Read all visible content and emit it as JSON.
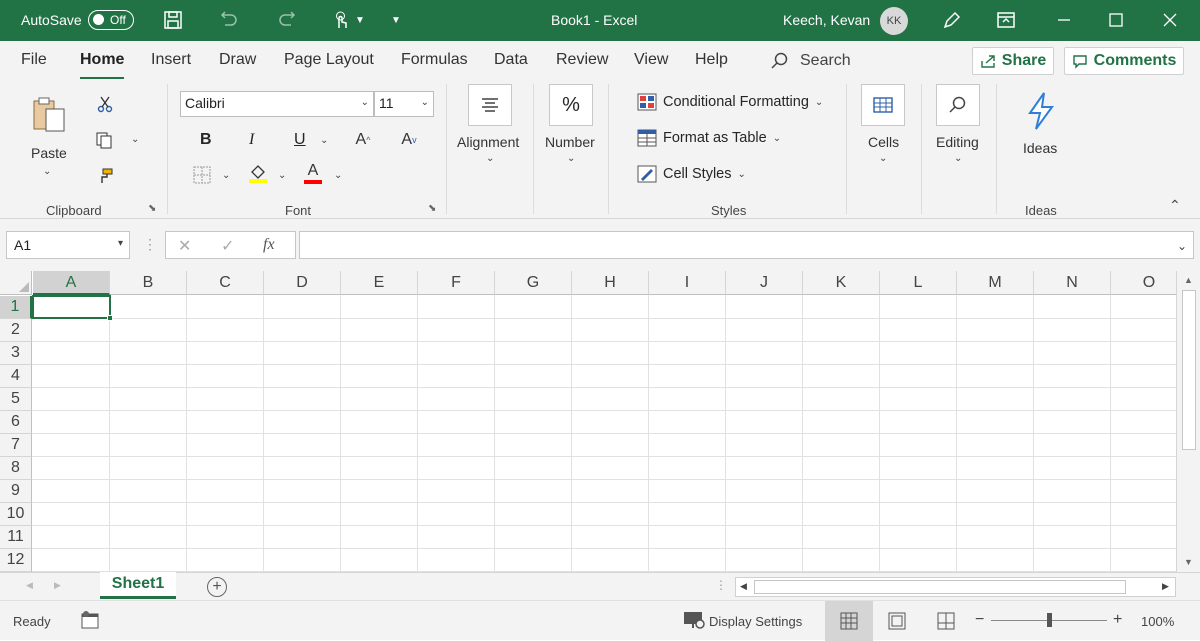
{
  "titlebar": {
    "autosave_label": "AutoSave",
    "autosave_state": "Off",
    "document_title": "Book1  -  Excel",
    "user_name": "Keech, Kevan",
    "user_initials": "KK"
  },
  "tabs": [
    "File",
    "Home",
    "Insert",
    "Draw",
    "Page Layout",
    "Formulas",
    "Data",
    "Review",
    "View",
    "Help"
  ],
  "search_label": "Search",
  "share_label": "Share",
  "comments_label": "Comments",
  "clipboard": {
    "paste_label": "Paste",
    "group_label": "Clipboard"
  },
  "font": {
    "name": "Calibri",
    "size": "11",
    "group_label": "Font",
    "bold": "B",
    "italic": "I",
    "underline": "U",
    "font_color_letter": "A",
    "highlight_color": "#ffff00",
    "font_color": "#ff0000"
  },
  "alignment": {
    "label": "Alignment"
  },
  "number": {
    "label": "Number",
    "icon_text": "%"
  },
  "styles": {
    "conditional_formatting": "Conditional Formatting",
    "format_as_table": "Format as Table",
    "cell_styles": "Cell Styles",
    "group_label": "Styles"
  },
  "cells": {
    "label": "Cells"
  },
  "editing": {
    "label": "Editing"
  },
  "ideas": {
    "button_label": "Ideas",
    "group_label": "Ideas"
  },
  "formula_bar": {
    "name_box": "A1",
    "fx": "fx",
    "value": ""
  },
  "grid": {
    "columns": [
      "A",
      "B",
      "C",
      "D",
      "E",
      "F",
      "G",
      "H",
      "I",
      "J",
      "K",
      "L",
      "M",
      "N",
      "O"
    ],
    "rows": [
      "1",
      "2",
      "3",
      "4",
      "5",
      "6",
      "7",
      "8",
      "9",
      "10",
      "11",
      "12"
    ],
    "active_cell": "A1"
  },
  "sheet": {
    "tab_label": "Sheet1"
  },
  "status": {
    "ready": "Ready",
    "display_settings": "Display Settings",
    "zoom_minus": "−",
    "zoom_plus": "+",
    "zoom": "100%"
  },
  "colors": {
    "accent": "#217346"
  }
}
